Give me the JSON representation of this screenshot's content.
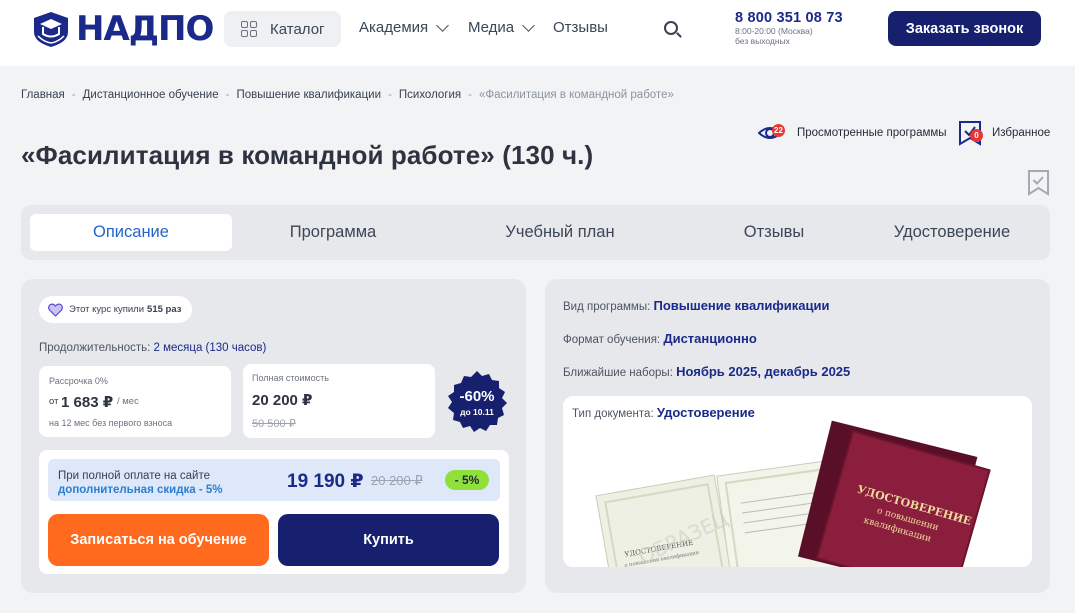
{
  "header": {
    "logo_text": "НАДПО",
    "catalog_label": "Каталог",
    "nav": [
      {
        "label": "Академия"
      },
      {
        "label": "Медиа"
      },
      {
        "label": "Отзывы"
      }
    ],
    "phone": "8 800 351 08 73",
    "phone_hours": "8:00-20:00 (Москва)",
    "phone_days": "без выходных",
    "callback_label": "Заказать звонок"
  },
  "breadcrumb": [
    "Главная",
    "Дистанционное обучение",
    "Повышение квалификации",
    "Психология",
    "«Фасилитация в командной работе»"
  ],
  "viewed": {
    "label": "Просмотренные программы",
    "count": "22"
  },
  "favorites": {
    "label": "Избранное",
    "count": "0"
  },
  "title": "«Фасилитация в командной работе» (130 ч.)",
  "tabs": [
    {
      "label": "Описание",
      "active": true
    },
    {
      "label": "Программа"
    },
    {
      "label": "Учебный план"
    },
    {
      "label": "Отзывы"
    },
    {
      "label": "Удостоверение"
    }
  ],
  "purchase": {
    "bought_prefix": "Этот курс купили",
    "bought_count": "515 раз",
    "duration_label": "Продолжительность:",
    "duration_value": "2 месяца (130 часов)",
    "installment_label": "Рассрочка 0%",
    "installment_from": "от",
    "installment_price": "1 683 ₽",
    "installment_unit": "/ мес",
    "installment_note": "на 12 мес без первого взноса",
    "full_label": "Полная стоимость",
    "full_price": "20 200 ₽",
    "full_old_price": "50 500 ₽",
    "sale_percent": "-60%",
    "sale_until": "до 10.11",
    "promo_line1": "При полной оплате на сайте",
    "promo_line2": "дополнительная скидка - 5%",
    "promo_price": "19 190 ₽",
    "promo_old_price": "20 200 ₽",
    "promo_discount": "- 5%",
    "enroll_label": "Записаться на обучение",
    "buy_label": "Купить"
  },
  "program_info": {
    "type_label": "Вид программы:",
    "type_value": "Повышение квалификации",
    "format_label": "Формат обучения:",
    "format_value": "Дистанционно",
    "start_label": "Ближайшие наборы:",
    "start_value": "Ноябрь 2025, декабрь 2025",
    "doc_label": "Тип документа:",
    "doc_value": "Удостоверение",
    "cover_title": "УДОСТОВЕРЕНИЕ",
    "cover_sub1": "о повышении",
    "cover_sub2": "квалификации",
    "inner_title": "УДОСТОВЕРЕНИЕ",
    "inner_sub": "о повышении квалификации",
    "watermark": "ОБРАЗЕЦ"
  },
  "colors": {
    "brand": "#1b2a8a",
    "accent_orange": "#ff6a1f",
    "accent_green": "#8fe03a",
    "link_blue": "#2563c9",
    "badge_red": "#e53935"
  }
}
